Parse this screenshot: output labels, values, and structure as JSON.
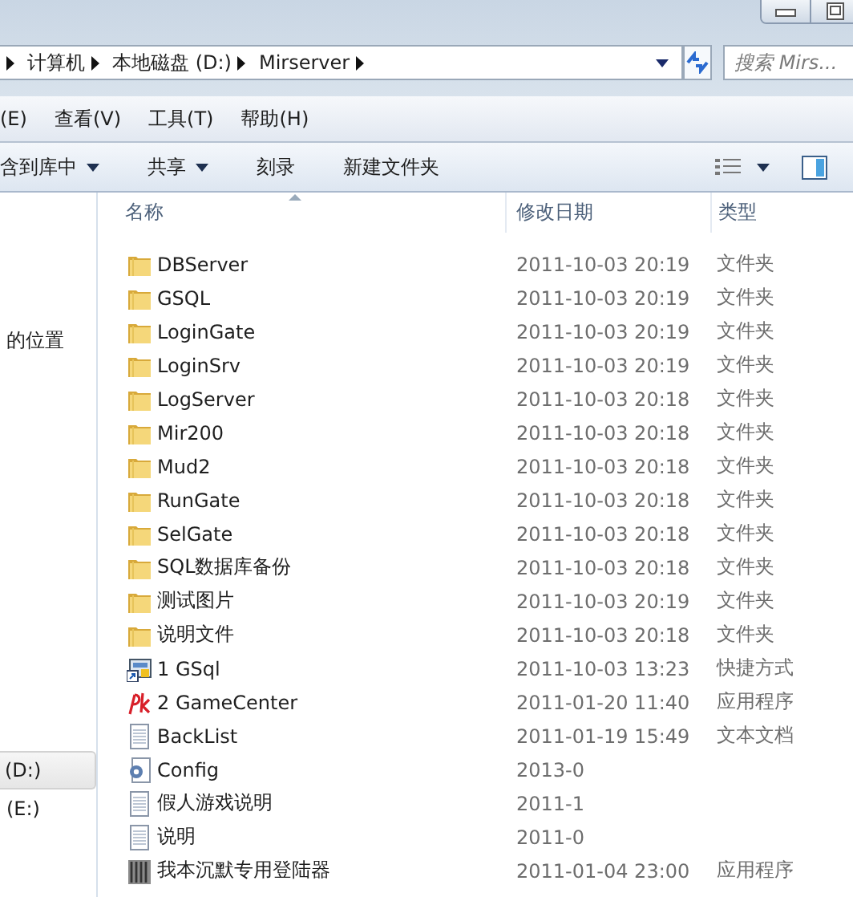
{
  "address_bar": {
    "breadcrumbs": [
      "计算机",
      "本地磁盘 (D:)",
      "Mirserver"
    ]
  },
  "search": {
    "placeholder": "搜索 Mirs..."
  },
  "menu_bar": [
    "(E)",
    "查看(V)",
    "工具(T)",
    "帮助(H)"
  ],
  "toolbar": [
    {
      "label": "含到库中",
      "kind": "menu"
    },
    {
      "label": "共享",
      "kind": "menu"
    },
    {
      "label": "刻录",
      "kind": "plain"
    },
    {
      "label": "新建文件夹",
      "kind": "plain"
    }
  ],
  "nav_pane": {
    "favorites": [
      {
        "label": "的位置",
        "selected": false
      }
    ],
    "drives": [
      {
        "label": "(D:)",
        "selected": true
      },
      {
        "label": "(E:)",
        "selected": false
      }
    ]
  },
  "columns": [
    {
      "label": "名称",
      "sorted": true
    },
    {
      "label": "修改日期",
      "sorted": false
    },
    {
      "label": "类型",
      "sorted": false
    }
  ],
  "rows": [
    {
      "name": "DBServer",
      "kind": "folder",
      "date": "2011-10-03 20:19",
      "type": "文件夹"
    },
    {
      "name": "GSQL",
      "kind": "folder",
      "date": "2011-10-03 20:19",
      "type": "文件夹"
    },
    {
      "name": "LoginGate",
      "kind": "folder",
      "date": "2011-10-03 20:19",
      "type": "文件夹"
    },
    {
      "name": "LoginSrv",
      "kind": "folder",
      "date": "2011-10-03 20:19",
      "type": "文件夹"
    },
    {
      "name": "LogServer",
      "kind": "folder",
      "date": "2011-10-03 20:18",
      "type": "文件夹"
    },
    {
      "name": "Mir200",
      "kind": "folder",
      "date": "2011-10-03 20:18",
      "type": "文件夹"
    },
    {
      "name": "Mud2",
      "kind": "folder",
      "date": "2011-10-03 20:18",
      "type": "文件夹"
    },
    {
      "name": "RunGate",
      "kind": "folder",
      "date": "2011-10-03 20:18",
      "type": "文件夹"
    },
    {
      "name": "SelGate",
      "kind": "folder",
      "date": "2011-10-03 20:18",
      "type": "文件夹"
    },
    {
      "name": "SQL数据库备份",
      "kind": "folder",
      "date": "2011-10-03 20:18",
      "type": "文件夹"
    },
    {
      "name": "测试图片",
      "kind": "folder",
      "date": "2011-10-03 20:19",
      "type": "文件夹"
    },
    {
      "name": "说明文件",
      "kind": "folder",
      "date": "2011-10-03 20:18",
      "type": "文件夹"
    },
    {
      "name": "1 GSql",
      "kind": "shortcut",
      "date": "2011-10-03 13:23",
      "type": "快捷方式"
    },
    {
      "name": "2 GameCenter",
      "kind": "game",
      "date": "2011-01-20 11:40",
      "type": "应用程序"
    },
    {
      "name": "BackList",
      "kind": "text",
      "date": "2011-01-19 15:49",
      "type": "文本文档"
    },
    {
      "name": "Config",
      "kind": "config",
      "date": "2013-0"
    },
    {
      "name": "假人游戏说明",
      "kind": "text",
      "date": "2011-1"
    },
    {
      "name": "说明",
      "kind": "text",
      "date": "2011-0"
    },
    {
      "name": "我本沉默专用登陆器",
      "kind": "app",
      "date": "2011-01-04 23:00",
      "type": "应用程序"
    }
  ]
}
